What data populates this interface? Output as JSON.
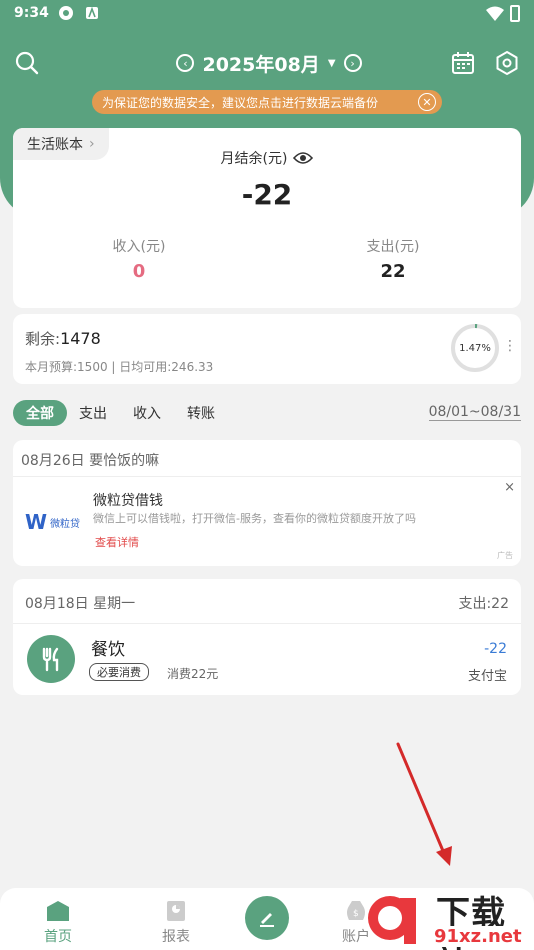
{
  "status_bar": {
    "time": "9:34"
  },
  "header": {
    "month": "2025年08月",
    "banner": "为保证您的数据安全，建议您点击进行数据云端备份"
  },
  "summary": {
    "book_name": "生活账本",
    "balance_label": "月结余(元)",
    "balance_value": "-22",
    "income_label": "收入(元)",
    "income_value": "0",
    "expense_label": "支出(元)",
    "expense_value": "22"
  },
  "budget": {
    "remain_label": "剩余:",
    "remain_value": "1478",
    "detail": "本月预算:1500 | 日均可用:246.33",
    "percent_text": "1.47%",
    "percent_used": 1.47
  },
  "filters": {
    "items": [
      "全部",
      "支出",
      "收入",
      "转账"
    ],
    "range": "08/01~08/31"
  },
  "ad_group": {
    "date_label": "08月26日  要恰饭的嘛",
    "logo_mark": "W",
    "logo_text": "微粒贷",
    "title": "微粒贷借钱",
    "desc": "微信上可以借钱啦，打开微信-服务，查看你的微粒贷额度开放了吗",
    "link": "查看详情",
    "close": "×",
    "tag": "广告"
  },
  "tx_group": {
    "date": "08月18日    星期一",
    "total": "支出:22",
    "category": "餐饮",
    "tag": "必要消费",
    "note": "消费22元",
    "amount": "-22",
    "method": "支付宝"
  },
  "tabbar": {
    "home": "首页",
    "report": "报表",
    "account": "账户"
  },
  "watermark": {
    "big": "下载站",
    "url": "91xz.net"
  },
  "colors": {
    "primary": "#5aa27f",
    "banner": "#e39a50",
    "income": "#e56b81",
    "amount": "#3a7bd5"
  }
}
